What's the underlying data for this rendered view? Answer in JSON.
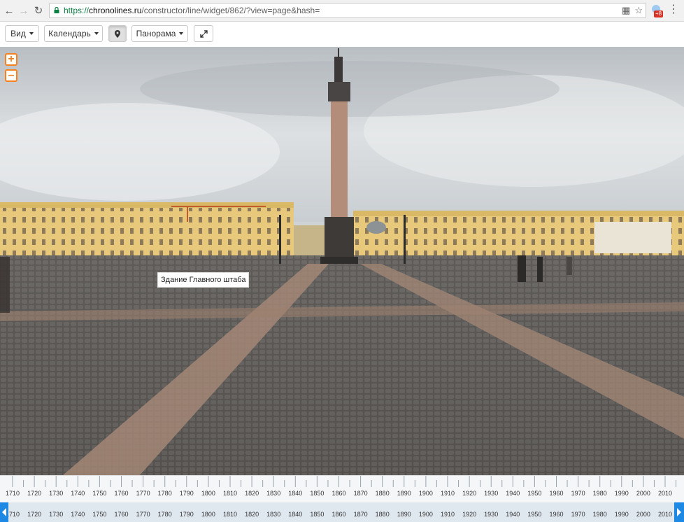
{
  "browser": {
    "url_scheme": "https://",
    "url_host": "chronolines.ru",
    "url_path": "/constructor/line/widget/862/?view=page&hash=",
    "ext_badge": "+8"
  },
  "toolbar": {
    "view_label": "Вид",
    "calendar_label": "Календарь",
    "panorama_label": "Панорама"
  },
  "panorama": {
    "marker_label": "Здание Главного штаба"
  },
  "timeline": {
    "years": [
      "1710",
      "1720",
      "1730",
      "1740",
      "1750",
      "1760",
      "1770",
      "1780",
      "1790",
      "1800",
      "1810",
      "1820",
      "1830",
      "1840",
      "1850",
      "1860",
      "1870",
      "1880",
      "1890",
      "1900",
      "1910",
      "1920",
      "1930",
      "1940",
      "1950",
      "1960",
      "1970",
      "1980",
      "1990",
      "2000",
      "2010"
    ]
  },
  "colors": {
    "accent": "#f58220",
    "timeline_blue": "#1e88e5"
  }
}
